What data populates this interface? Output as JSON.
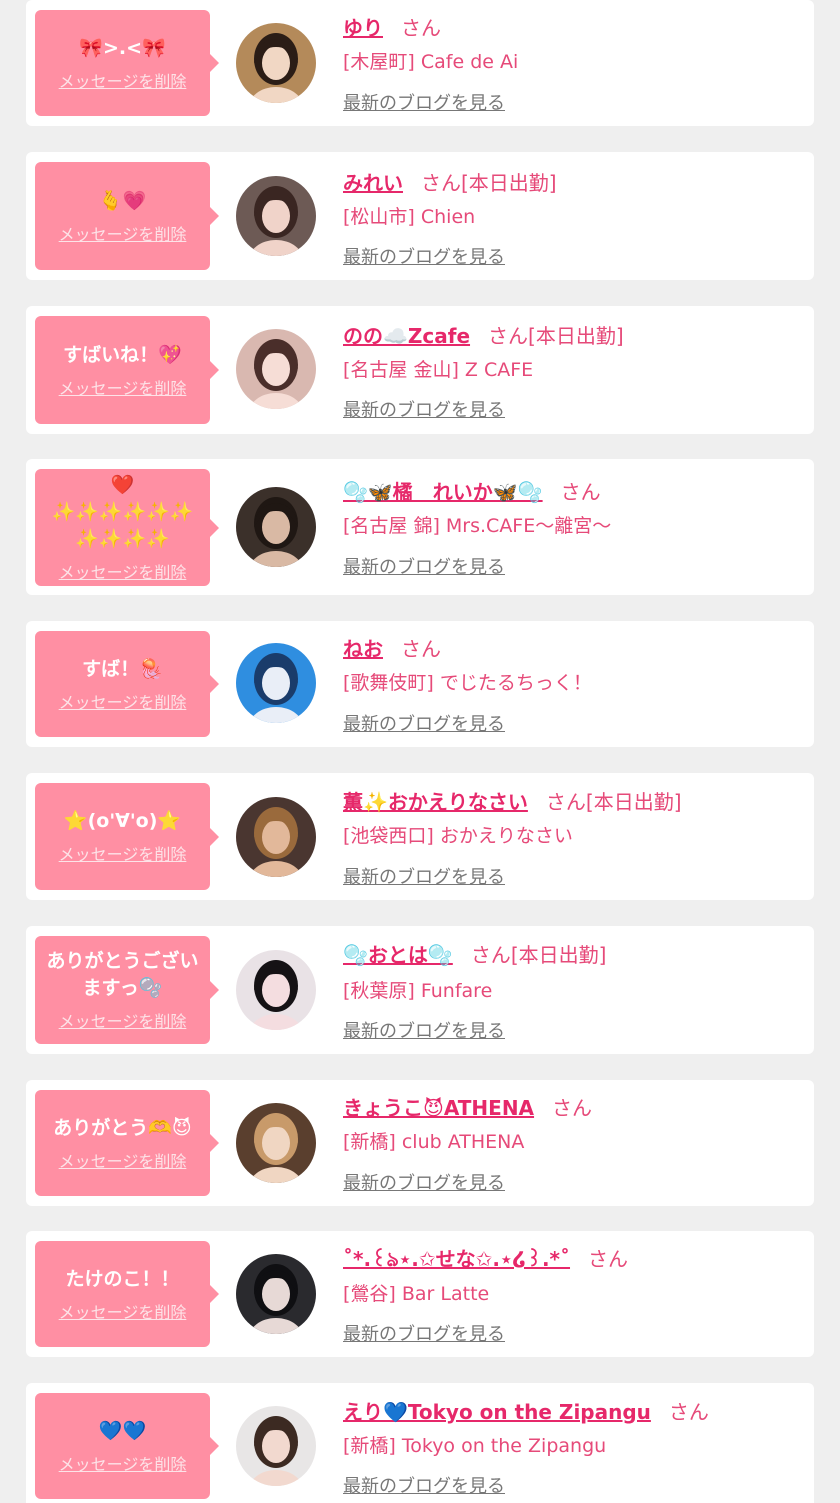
{
  "delete_label": "メッセージを削除",
  "blog_label": "最新のブログを見る",
  "san_label": "さん",
  "colors": {
    "bubble": "#ff8fa3",
    "name": "#e6286a",
    "text_pink": "#e64a79",
    "link_gray": "#777777",
    "page_bg": "#efefef"
  },
  "entries": [
    {
      "message": "🎀>.<🎀",
      "name": "ゆり",
      "shift": "",
      "shop": "[木屋町] Cafe de Ai",
      "avatar_icon": "girl-photo-avatar",
      "avatar_colors": [
        "#b48a5a",
        "#f1d7c4",
        "#2b1d16"
      ]
    },
    {
      "message": "🫰💗",
      "name": "みれい",
      "shift": "[本日出勤]",
      "shop": "[松山市] Chien",
      "avatar_icon": "girl-photo-avatar",
      "avatar_colors": [
        "#6d5a55",
        "#f0d3c9",
        "#3a2622"
      ]
    },
    {
      "message": "すばいね！💖",
      "name": "のの☁️Zcafe",
      "shift": "[本日出勤]",
      "shop": "[名古屋 金山] Z CAFE",
      "avatar_icon": "girl-photo-avatar",
      "avatar_colors": [
        "#d9b8b0",
        "#f6ddd6",
        "#4a2e2a"
      ]
    },
    {
      "message": "❤️\n✨✨✨✨✨✨\n✨✨✨✨",
      "name": "🫧🦋橘　れいか🦋🫧",
      "shift": "",
      "shop": "[名古屋 錦] Mrs.CAFE〜離宮〜",
      "avatar_icon": "girl-photo-avatar",
      "avatar_colors": [
        "#3b302a",
        "#d9b9a4",
        "#1f1713"
      ]
    },
    {
      "message": "すば！🪼",
      "name": "ねお",
      "shift": "",
      "shop": "[歌舞伎町] でじたるちっく！",
      "avatar_icon": "girl-photo-avatar",
      "avatar_colors": [
        "#2f8ee0",
        "#e9eef7",
        "#1a3c6b"
      ]
    },
    {
      "message": "⭐(o'∀'o)⭐",
      "name": "薫✨おかえりなさい",
      "shift": "[本日出勤]",
      "shop": "[池袋西口] おかえりなさい",
      "avatar_icon": "girl-photo-avatar",
      "avatar_colors": [
        "#4a3630",
        "#e2b89a",
        "#9a6a3c"
      ]
    },
    {
      "message": "ありがとうござい\nますっ🫧",
      "name": "🫧おとは🫧",
      "shift": "[本日出勤]",
      "shop": "[秋葉原] Funfare",
      "avatar_icon": "girl-photo-avatar",
      "avatar_colors": [
        "#e9e2e6",
        "#f4dde0",
        "#151215"
      ]
    },
    {
      "message": "ありがとう🫶😈",
      "name": "きょうこ😈ATHENA",
      "shift": "",
      "shop": "[新橋] club ATHENA",
      "avatar_icon": "girl-photo-avatar",
      "avatar_colors": [
        "#5a3f2e",
        "#f0d6c2",
        "#c89a6a"
      ]
    },
    {
      "message": "たけのこ！！",
      "name": "˚*.꒰ঌ⋆.✩せな✩.⋆໒꒱.*˚",
      "shift": "",
      "shop": "[鶯谷] Bar Latte",
      "avatar_icon": "girl-photo-avatar",
      "avatar_colors": [
        "#2a2a2e",
        "#e7d9d6",
        "#0f0f12"
      ]
    },
    {
      "message": "💙💙",
      "name": "えり💙Tokyo on the Zipangu",
      "shift": "",
      "shop": "[新橋] Tokyo on the Zipangu",
      "avatar_icon": "girl-photo-avatar",
      "avatar_colors": [
        "#e8e6e6",
        "#f2d9cf",
        "#3c2a22"
      ]
    }
  ]
}
